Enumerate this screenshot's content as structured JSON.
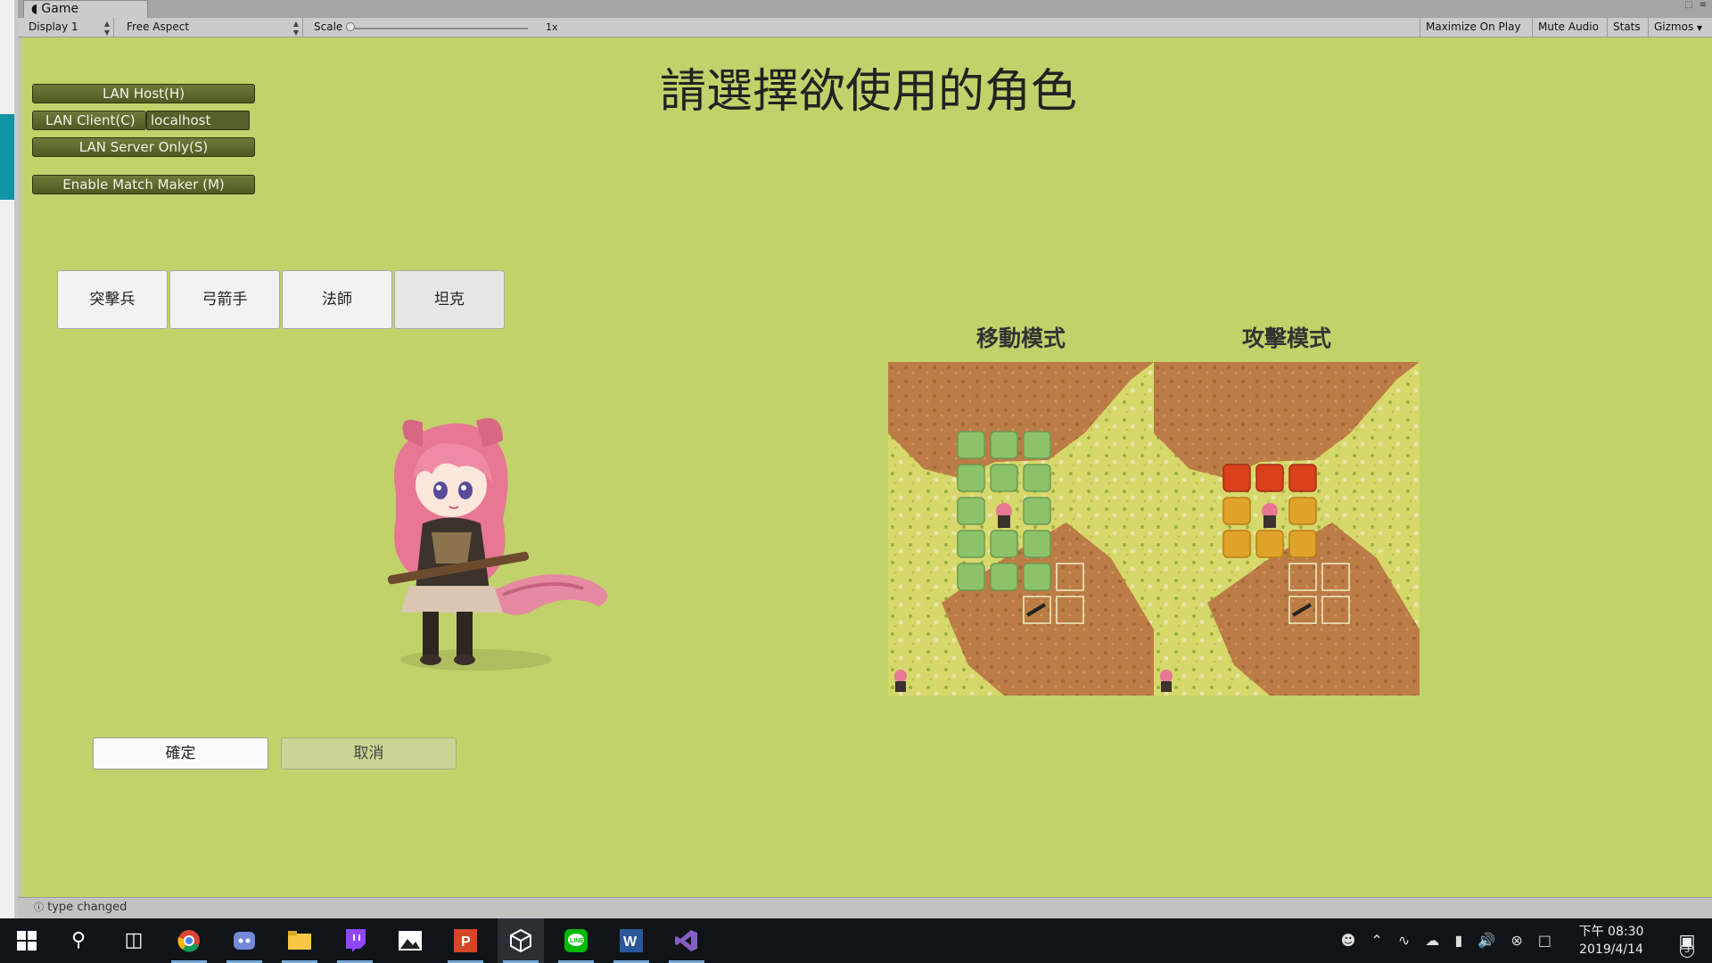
{
  "editor": {
    "tab_title": "Game",
    "toolbar": {
      "display": "Display 1",
      "aspect": "Free Aspect",
      "scale_label": "Scale",
      "scale_value": "1x",
      "maximize": "Maximize On Play",
      "mute": "Mute Audio",
      "stats": "Stats",
      "gizmos": "Gizmos"
    },
    "status_message": "type changed"
  },
  "game": {
    "title": "請選擇欲使用的角色",
    "network": {
      "lan_host": "LAN Host(H)",
      "lan_client": "LAN Client(C)",
      "host_address": "localhost",
      "lan_server": "LAN Server Only(S)",
      "match_maker": "Enable Match Maker (M)"
    },
    "roles": [
      "突擊兵",
      "弓箭手",
      "法師",
      "坦克"
    ],
    "modes": {
      "move": "移動模式",
      "attack": "攻擊模式"
    },
    "confirm": "確定",
    "cancel": "取消"
  },
  "taskbar": {
    "apps": [
      "windows-start-icon",
      "search-icon",
      "task-view-icon",
      "chrome-icon",
      "discord-icon",
      "file-explorer-icon",
      "twitch-icon",
      "photos-icon",
      "powerpoint-icon",
      "unity-icon",
      "line-icon",
      "word-icon",
      "visual-studio-icon"
    ],
    "clock_time": "下午 08:30",
    "clock_date": "2019/4/14",
    "notification_count": "3"
  }
}
